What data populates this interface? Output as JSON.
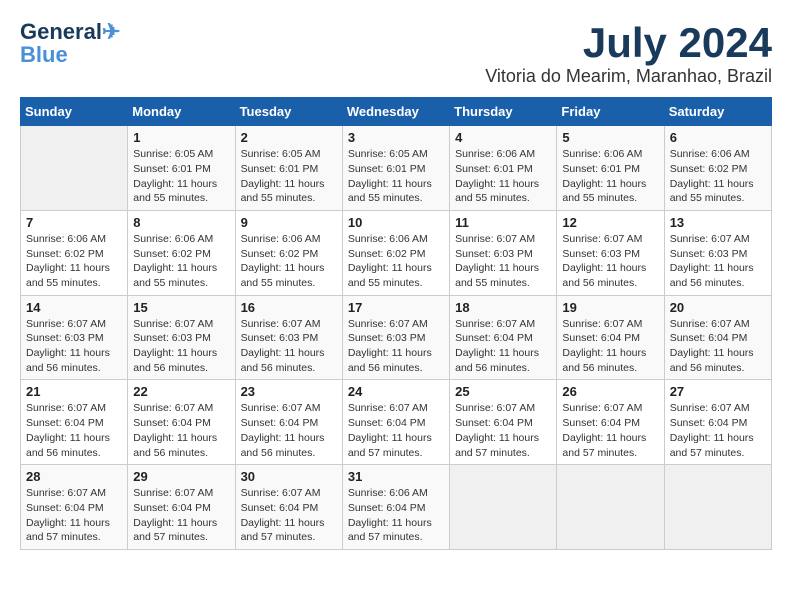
{
  "logo": {
    "line1": "General",
    "line2": "Blue"
  },
  "title": "July 2024",
  "location": "Vitoria do Mearim, Maranhao, Brazil",
  "days_of_week": [
    "Sunday",
    "Monday",
    "Tuesday",
    "Wednesday",
    "Thursday",
    "Friday",
    "Saturday"
  ],
  "weeks": [
    [
      {
        "day": "",
        "info": ""
      },
      {
        "day": "1",
        "info": "Sunrise: 6:05 AM\nSunset: 6:01 PM\nDaylight: 11 hours\nand 55 minutes."
      },
      {
        "day": "2",
        "info": "Sunrise: 6:05 AM\nSunset: 6:01 PM\nDaylight: 11 hours\nand 55 minutes."
      },
      {
        "day": "3",
        "info": "Sunrise: 6:05 AM\nSunset: 6:01 PM\nDaylight: 11 hours\nand 55 minutes."
      },
      {
        "day": "4",
        "info": "Sunrise: 6:06 AM\nSunset: 6:01 PM\nDaylight: 11 hours\nand 55 minutes."
      },
      {
        "day": "5",
        "info": "Sunrise: 6:06 AM\nSunset: 6:01 PM\nDaylight: 11 hours\nand 55 minutes."
      },
      {
        "day": "6",
        "info": "Sunrise: 6:06 AM\nSunset: 6:02 PM\nDaylight: 11 hours\nand 55 minutes."
      }
    ],
    [
      {
        "day": "7",
        "info": "Sunrise: 6:06 AM\nSunset: 6:02 PM\nDaylight: 11 hours\nand 55 minutes."
      },
      {
        "day": "8",
        "info": "Sunrise: 6:06 AM\nSunset: 6:02 PM\nDaylight: 11 hours\nand 55 minutes."
      },
      {
        "day": "9",
        "info": "Sunrise: 6:06 AM\nSunset: 6:02 PM\nDaylight: 11 hours\nand 55 minutes."
      },
      {
        "day": "10",
        "info": "Sunrise: 6:06 AM\nSunset: 6:02 PM\nDaylight: 11 hours\nand 55 minutes."
      },
      {
        "day": "11",
        "info": "Sunrise: 6:07 AM\nSunset: 6:03 PM\nDaylight: 11 hours\nand 55 minutes."
      },
      {
        "day": "12",
        "info": "Sunrise: 6:07 AM\nSunset: 6:03 PM\nDaylight: 11 hours\nand 56 minutes."
      },
      {
        "day": "13",
        "info": "Sunrise: 6:07 AM\nSunset: 6:03 PM\nDaylight: 11 hours\nand 56 minutes."
      }
    ],
    [
      {
        "day": "14",
        "info": "Sunrise: 6:07 AM\nSunset: 6:03 PM\nDaylight: 11 hours\nand 56 minutes."
      },
      {
        "day": "15",
        "info": "Sunrise: 6:07 AM\nSunset: 6:03 PM\nDaylight: 11 hours\nand 56 minutes."
      },
      {
        "day": "16",
        "info": "Sunrise: 6:07 AM\nSunset: 6:03 PM\nDaylight: 11 hours\nand 56 minutes."
      },
      {
        "day": "17",
        "info": "Sunrise: 6:07 AM\nSunset: 6:03 PM\nDaylight: 11 hours\nand 56 minutes."
      },
      {
        "day": "18",
        "info": "Sunrise: 6:07 AM\nSunset: 6:04 PM\nDaylight: 11 hours\nand 56 minutes."
      },
      {
        "day": "19",
        "info": "Sunrise: 6:07 AM\nSunset: 6:04 PM\nDaylight: 11 hours\nand 56 minutes."
      },
      {
        "day": "20",
        "info": "Sunrise: 6:07 AM\nSunset: 6:04 PM\nDaylight: 11 hours\nand 56 minutes."
      }
    ],
    [
      {
        "day": "21",
        "info": "Sunrise: 6:07 AM\nSunset: 6:04 PM\nDaylight: 11 hours\nand 56 minutes."
      },
      {
        "day": "22",
        "info": "Sunrise: 6:07 AM\nSunset: 6:04 PM\nDaylight: 11 hours\nand 56 minutes."
      },
      {
        "day": "23",
        "info": "Sunrise: 6:07 AM\nSunset: 6:04 PM\nDaylight: 11 hours\nand 56 minutes."
      },
      {
        "day": "24",
        "info": "Sunrise: 6:07 AM\nSunset: 6:04 PM\nDaylight: 11 hours\nand 57 minutes."
      },
      {
        "day": "25",
        "info": "Sunrise: 6:07 AM\nSunset: 6:04 PM\nDaylight: 11 hours\nand 57 minutes."
      },
      {
        "day": "26",
        "info": "Sunrise: 6:07 AM\nSunset: 6:04 PM\nDaylight: 11 hours\nand 57 minutes."
      },
      {
        "day": "27",
        "info": "Sunrise: 6:07 AM\nSunset: 6:04 PM\nDaylight: 11 hours\nand 57 minutes."
      }
    ],
    [
      {
        "day": "28",
        "info": "Sunrise: 6:07 AM\nSunset: 6:04 PM\nDaylight: 11 hours\nand 57 minutes."
      },
      {
        "day": "29",
        "info": "Sunrise: 6:07 AM\nSunset: 6:04 PM\nDaylight: 11 hours\nand 57 minutes."
      },
      {
        "day": "30",
        "info": "Sunrise: 6:07 AM\nSunset: 6:04 PM\nDaylight: 11 hours\nand 57 minutes."
      },
      {
        "day": "31",
        "info": "Sunrise: 6:06 AM\nSunset: 6:04 PM\nDaylight: 11 hours\nand 57 minutes."
      },
      {
        "day": "",
        "info": ""
      },
      {
        "day": "",
        "info": ""
      },
      {
        "day": "",
        "info": ""
      }
    ]
  ]
}
